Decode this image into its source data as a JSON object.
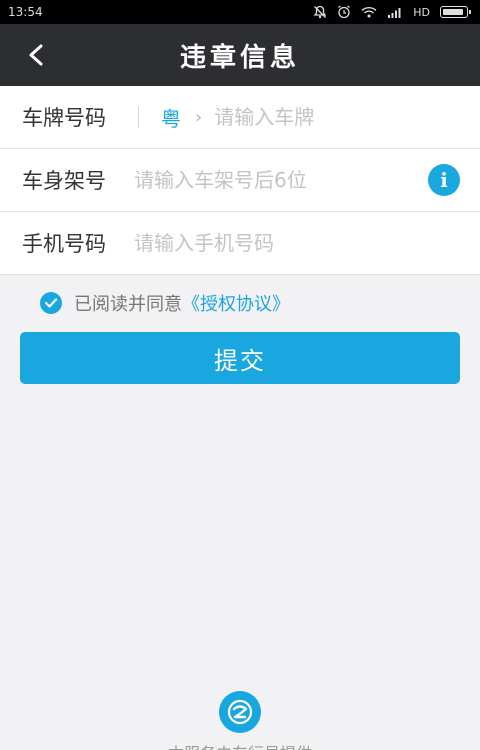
{
  "status_bar": {
    "time": "13:54",
    "network": "HD"
  },
  "nav": {
    "title": "违章信息"
  },
  "form": {
    "plate": {
      "label": "车牌号码",
      "province": "粤",
      "placeholder": "请输入车牌"
    },
    "vin": {
      "label": "车身架号",
      "placeholder": "请输入车架号后6位"
    },
    "phone": {
      "label": "手机号码",
      "placeholder": "请输入手机号码"
    }
  },
  "agreement": {
    "text": "已阅读并同意",
    "link": "《授权协议》",
    "checked": true
  },
  "submit": {
    "label": "提交"
  },
  "footer": {
    "text": "本服务由车行易提供"
  },
  "colors": {
    "accent": "#1aa7e0",
    "nav_bg": "#2c2e31",
    "page_bg": "#f2f2f4"
  },
  "icons": [
    "back-arrow-icon",
    "info-icon",
    "check-icon",
    "chevron-right-icon",
    "brand-logo-icon"
  ]
}
